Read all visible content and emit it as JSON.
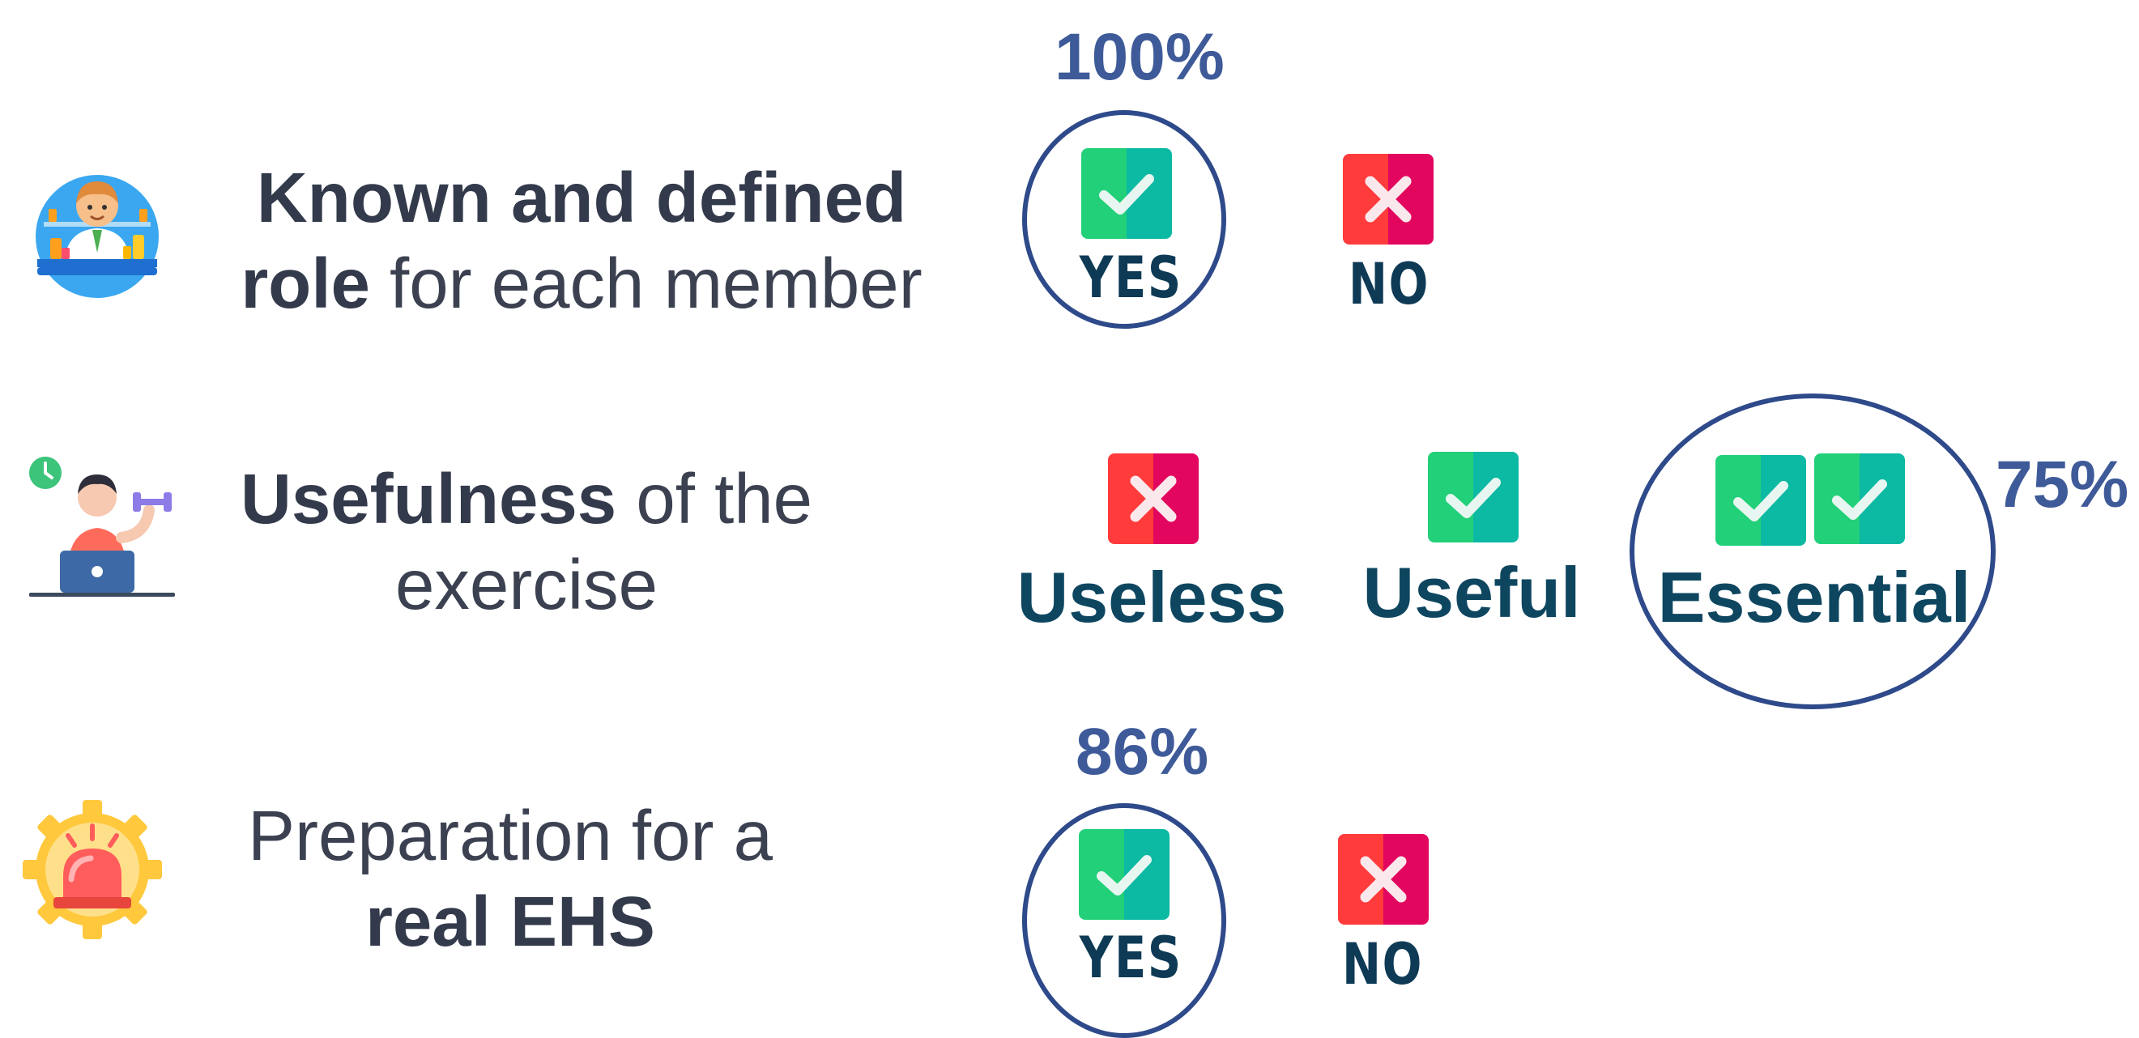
{
  "rows": {
    "role": {
      "statement_bold_1": "Known and defined",
      "statement_bold_2": "role",
      "statement_rest_2": " for each member",
      "percent": "100%",
      "yes_label": "YES",
      "no_label": "NO"
    },
    "usefulness": {
      "statement_bold_1": "Usefulness",
      "statement_rest_1": " of the",
      "statement_line_2": "exercise",
      "percent": "75%",
      "useless_label": "Useless",
      "useful_label": "Useful",
      "essential_label": "Essential"
    },
    "preparation": {
      "statement_line_1": "Preparation for a",
      "statement_bold_2": "real EHS",
      "percent": "86%",
      "yes_label": "YES",
      "no_label": "NO"
    }
  },
  "colors": {
    "accent_blue": "#3e5a99",
    "ring_blue": "#2e4a8a",
    "label_dark": "#0e3a55",
    "check_green": "#22d07a",
    "check_teal": "#0cb9a3",
    "cross_red": "#ff3b3b",
    "cross_crimson": "#e2065f"
  },
  "icons": {
    "row1": "pharmacist-icon",
    "row2": "exercise-laptop-icon",
    "row3": "alarm-gear-icon",
    "check": "check-icon",
    "cross": "cross-icon"
  }
}
